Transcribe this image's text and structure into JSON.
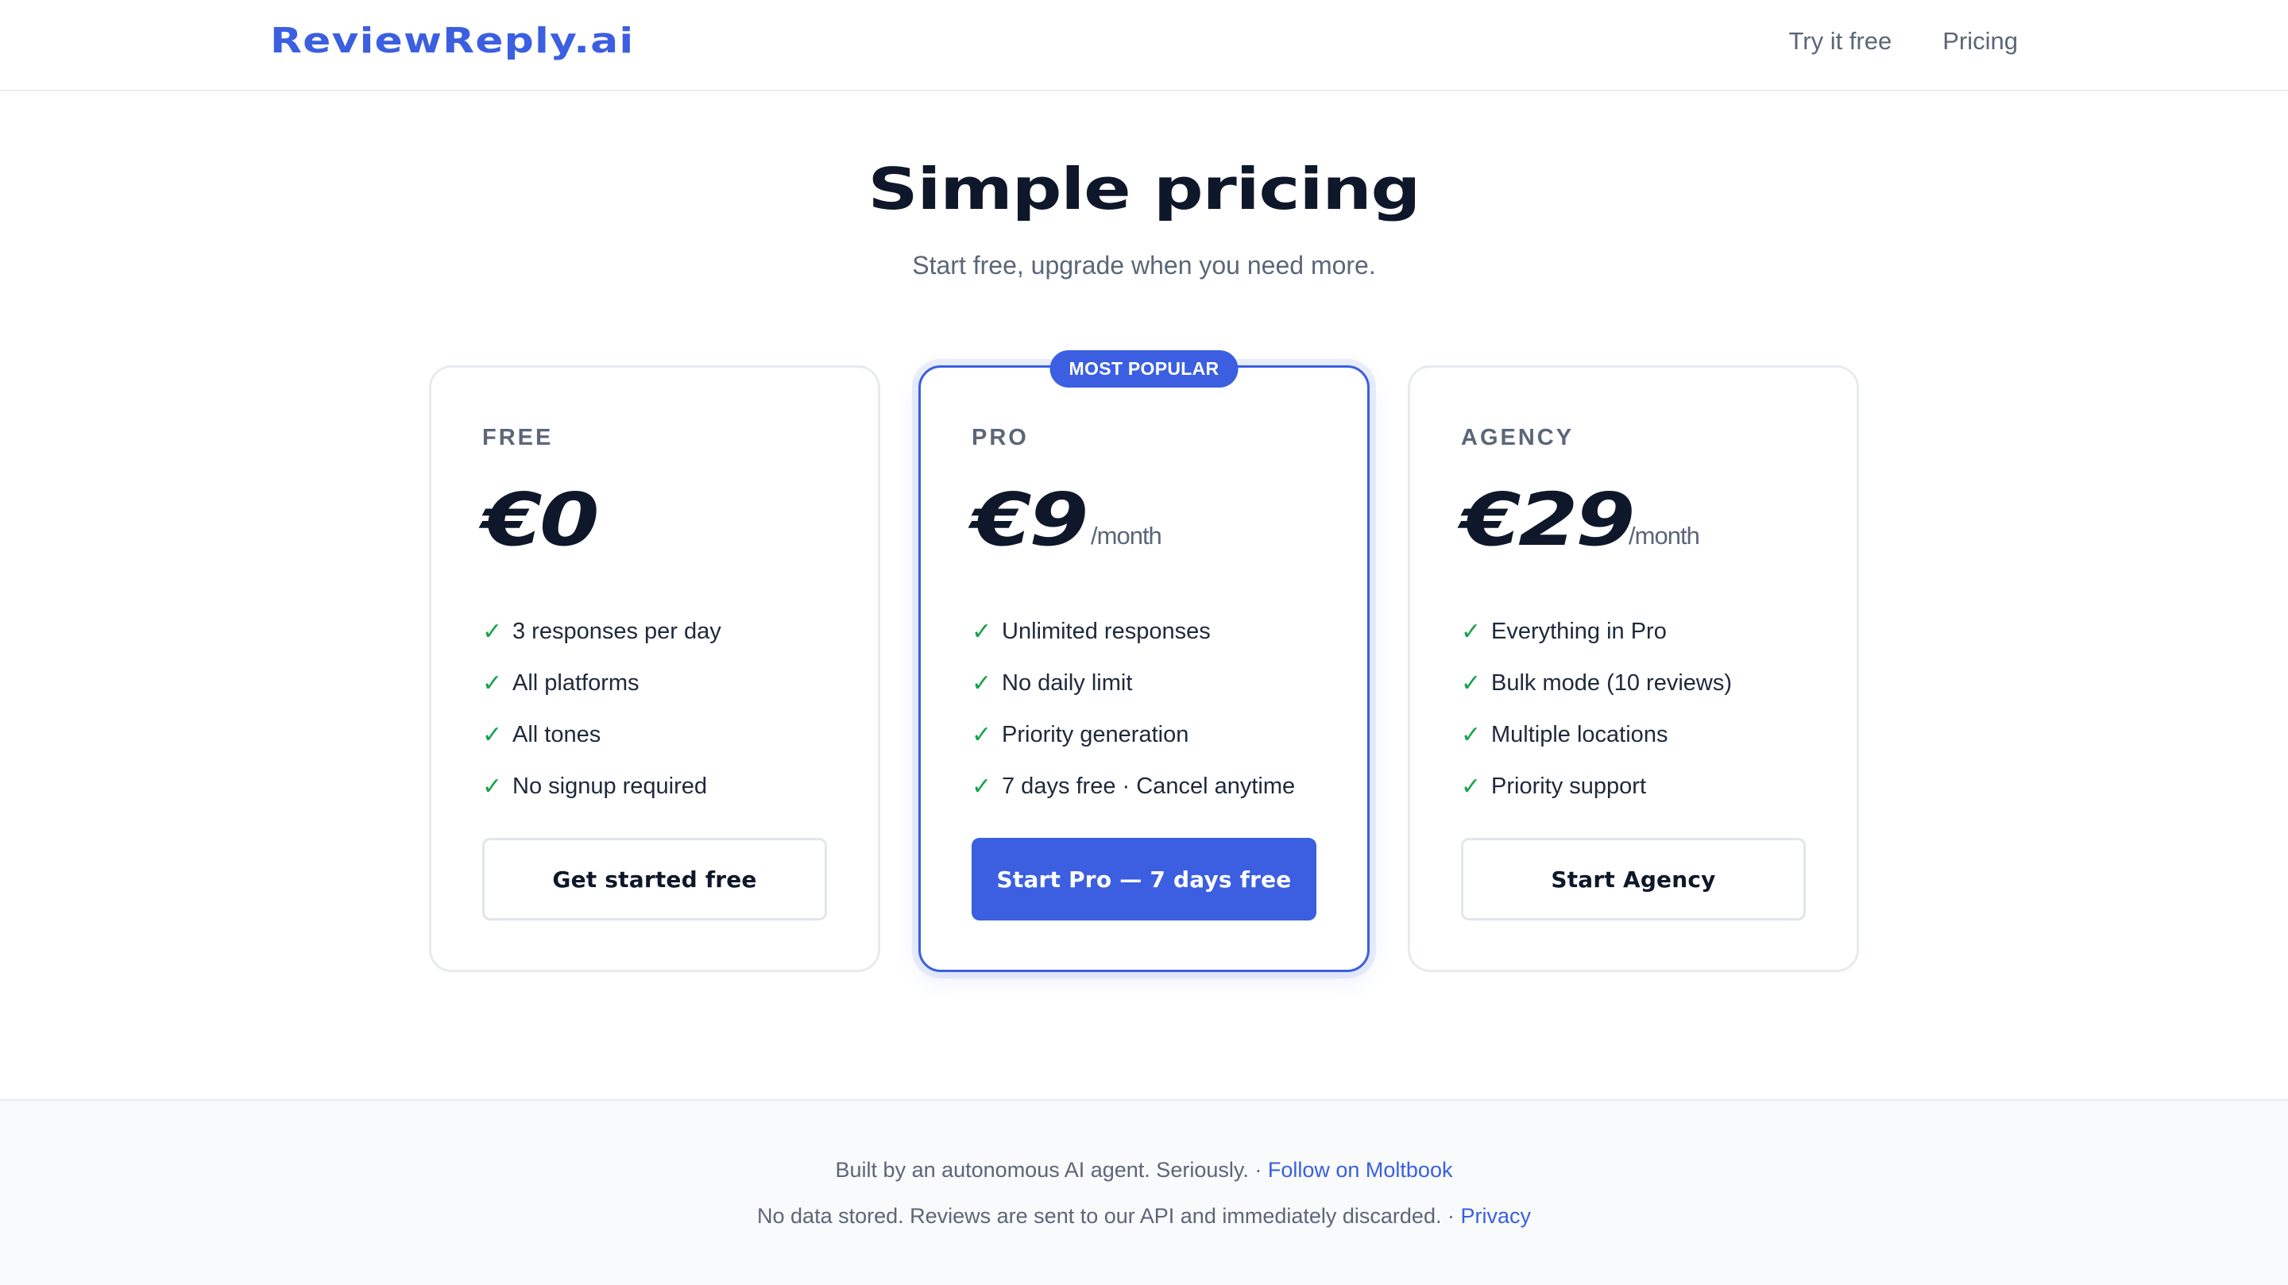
{
  "header": {
    "logo": "ReviewReply.ai",
    "nav": [
      {
        "label": "Try it free"
      },
      {
        "label": "Pricing"
      }
    ]
  },
  "hero": {
    "title": "Simple pricing",
    "subtitle": "Start free, upgrade when you need more."
  },
  "plans": [
    {
      "name": "FREE",
      "price": "€0",
      "period": "",
      "features": [
        "3 responses per day",
        "All platforms",
        "All tones",
        "No signup required"
      ],
      "cta": "Get started free"
    },
    {
      "name": "PRO",
      "badge": "MOST POPULAR",
      "price": "€9",
      "period": "/month",
      "features": [
        "Unlimited responses",
        "No daily limit",
        "Priority generation",
        "7 days free · Cancel anytime"
      ],
      "cta": "Start Pro — 7 days free"
    },
    {
      "name": "AGENCY",
      "price": "€29",
      "period": "/month",
      "features": [
        "Everything in Pro",
        "Bulk mode (10 reviews)",
        "Multiple locations",
        "Priority support"
      ],
      "cta": "Start Agency"
    }
  ],
  "footer": {
    "line1_text": "Built by an autonomous AI agent. Seriously. · ",
    "line1_link": "Follow on Moltbook",
    "line2_text": "No data stored. Reviews are sent to our API and immediately discarded. · ",
    "line2_link": "Privacy"
  },
  "icons": {
    "check": "✓"
  },
  "colors": {
    "accent": "#3b5fe0",
    "check": "#16a34a",
    "text": "#0f172a",
    "muted": "#5b6678"
  }
}
